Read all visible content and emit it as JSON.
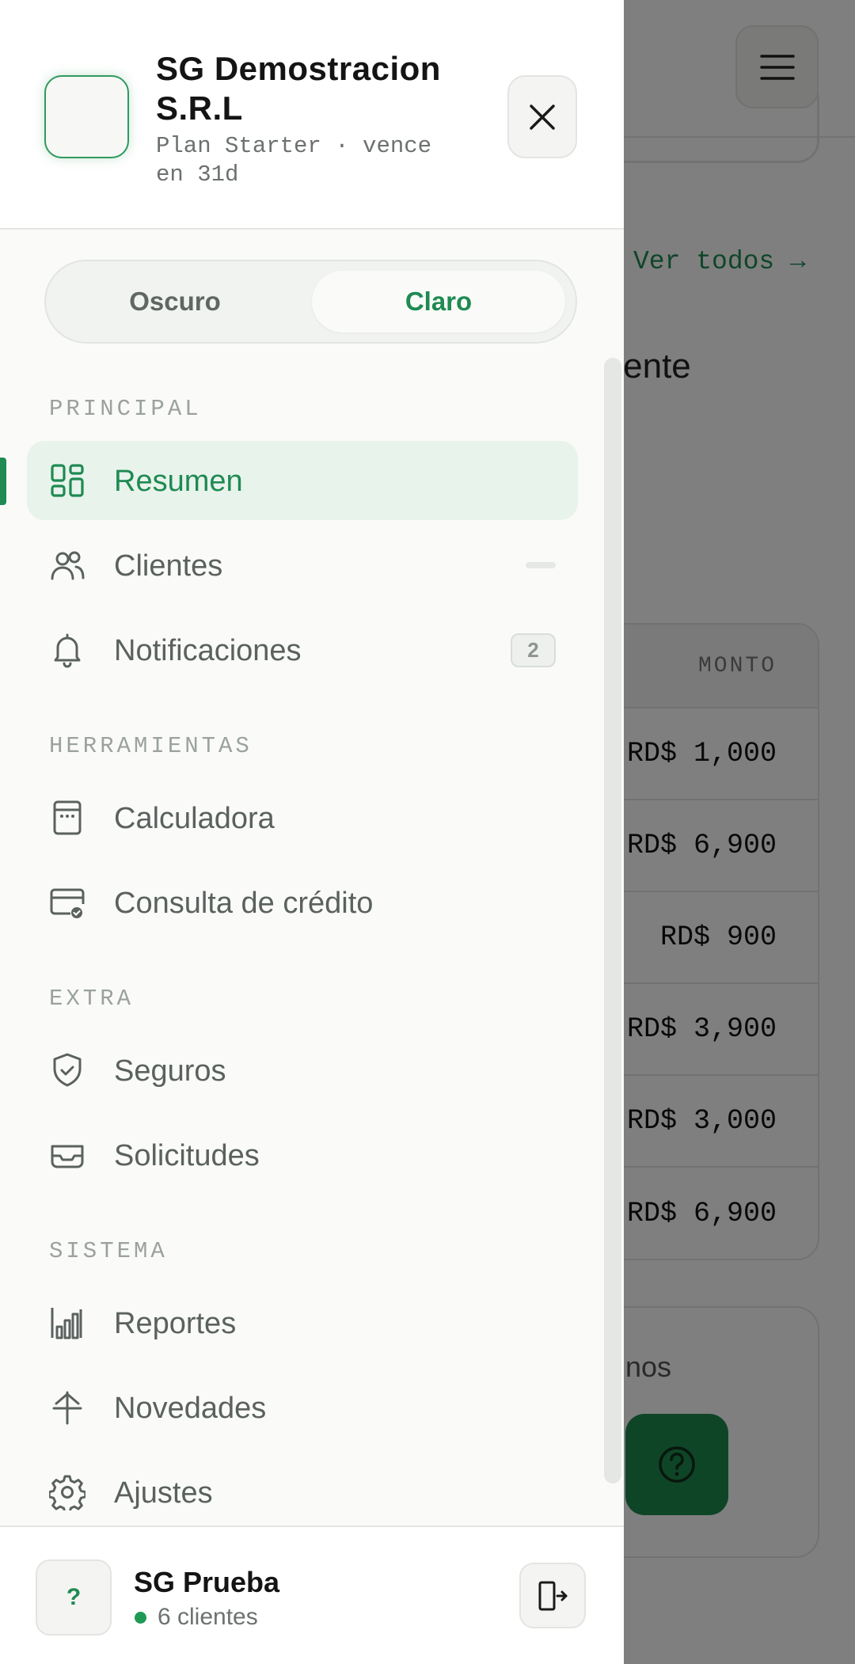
{
  "background": {
    "link_text": "Ver todos →",
    "heading_fragment": "rgente",
    "table": {
      "column_header": "MONTO",
      "amounts": [
        "RD$ 1,000",
        "RD$ 6,900",
        "RD$ 900",
        "RD$ 3,900",
        "RD$ 3,000",
        "RD$ 6,900"
      ]
    },
    "card_text_fragment": "nos"
  },
  "drawer": {
    "org_name": "SG Demostracion S.R.L",
    "plan_text": "Plan Starter · vence en 31d",
    "theme": {
      "dark_label": "Oscuro",
      "light_label": "Claro",
      "selected": "Claro"
    },
    "sections": {
      "principal": "PRINCIPAL",
      "herramientas": "HERRAMIENTAS",
      "extra": "EXTRA",
      "sistema": "SISTEMA"
    },
    "nav": {
      "resumen": "Resumen",
      "clientes": "Clientes",
      "notificaciones": "Notificaciones",
      "notificaciones_count": "2",
      "calculadora": "Calculadora",
      "consulta": "Consulta de crédito",
      "seguros": "Seguros",
      "solicitudes": "Solicitudes",
      "reportes": "Reportes",
      "novedades": "Novedades",
      "ajustes": "Ajustes"
    },
    "active_item": "Resumen",
    "footer": {
      "avatar_text": "?",
      "user_name": "SG Prueba",
      "status_text": "6 clientes"
    }
  },
  "colors": {
    "accent": "#1f8a52",
    "active_bg": "#e8f3ec",
    "overlay": "rgba(0,0,0,0.5)"
  },
  "icons": {
    "close": "close-icon",
    "menu": "menu-icon",
    "resumen": "grid-icon",
    "clientes": "users-icon",
    "notificaciones": "bell-icon",
    "calculadora": "calculator-icon",
    "consulta": "credit-card-check-icon",
    "seguros": "shield-check-icon",
    "solicitudes": "inbox-icon",
    "reportes": "bar-chart-icon",
    "novedades": "signpost-icon",
    "ajustes": "gear-icon",
    "logout": "logout-icon",
    "help": "help-icon"
  }
}
